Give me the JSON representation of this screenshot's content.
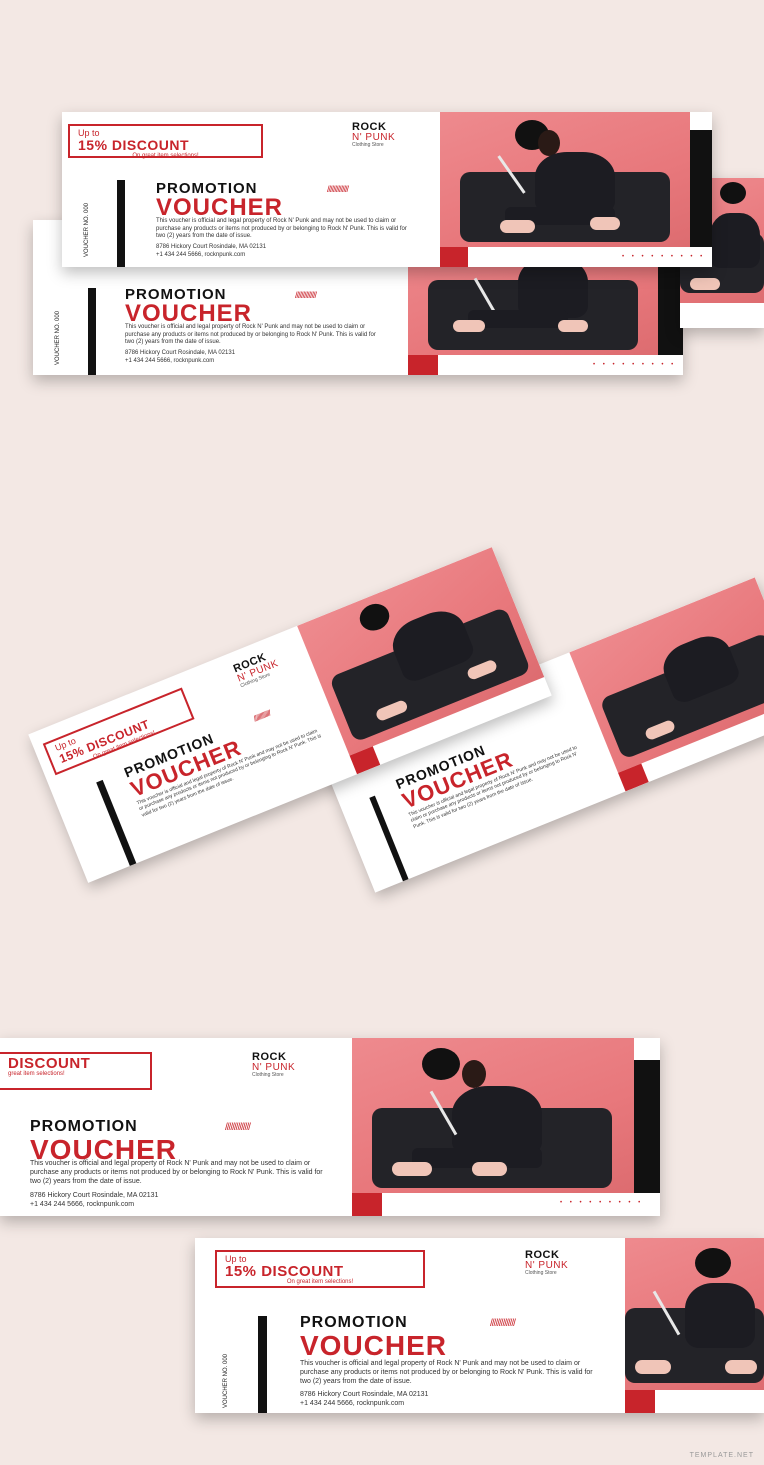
{
  "voucher": {
    "upto": "Up to",
    "discount": "15% DISCOUNT",
    "discount_short": "DISCOUNT",
    "subline": "On great item selections!",
    "subline_short": "great item selections!",
    "logo_rock": "ROCK",
    "logo_punk": "N' PUNK",
    "logo_sub": "Clothing Store",
    "promotion": "PROMOTION",
    "voucher_word": "VOUCHER",
    "voucher_no": "VOUCHER NO. 000",
    "body": "This voucher is official and legal property of Rock N' Punk and may not be used to claim or purchase any products or items not produced by or belonging to Rock N' Punk. This is valid for two (2) years from the date of issue.",
    "address": "8786 Hickory Court Rosindale, MA 02131",
    "contact": "+1 434 244 5666, rocknpunk.com",
    "slashes": "//////////////",
    "dots": "• • • • • • • • •"
  },
  "watermark": "TEMPLATE.NET",
  "colors": {
    "accent": "#c8242b",
    "photo_bg": "#e8787c",
    "page_bg": "#f3e8e4"
  }
}
